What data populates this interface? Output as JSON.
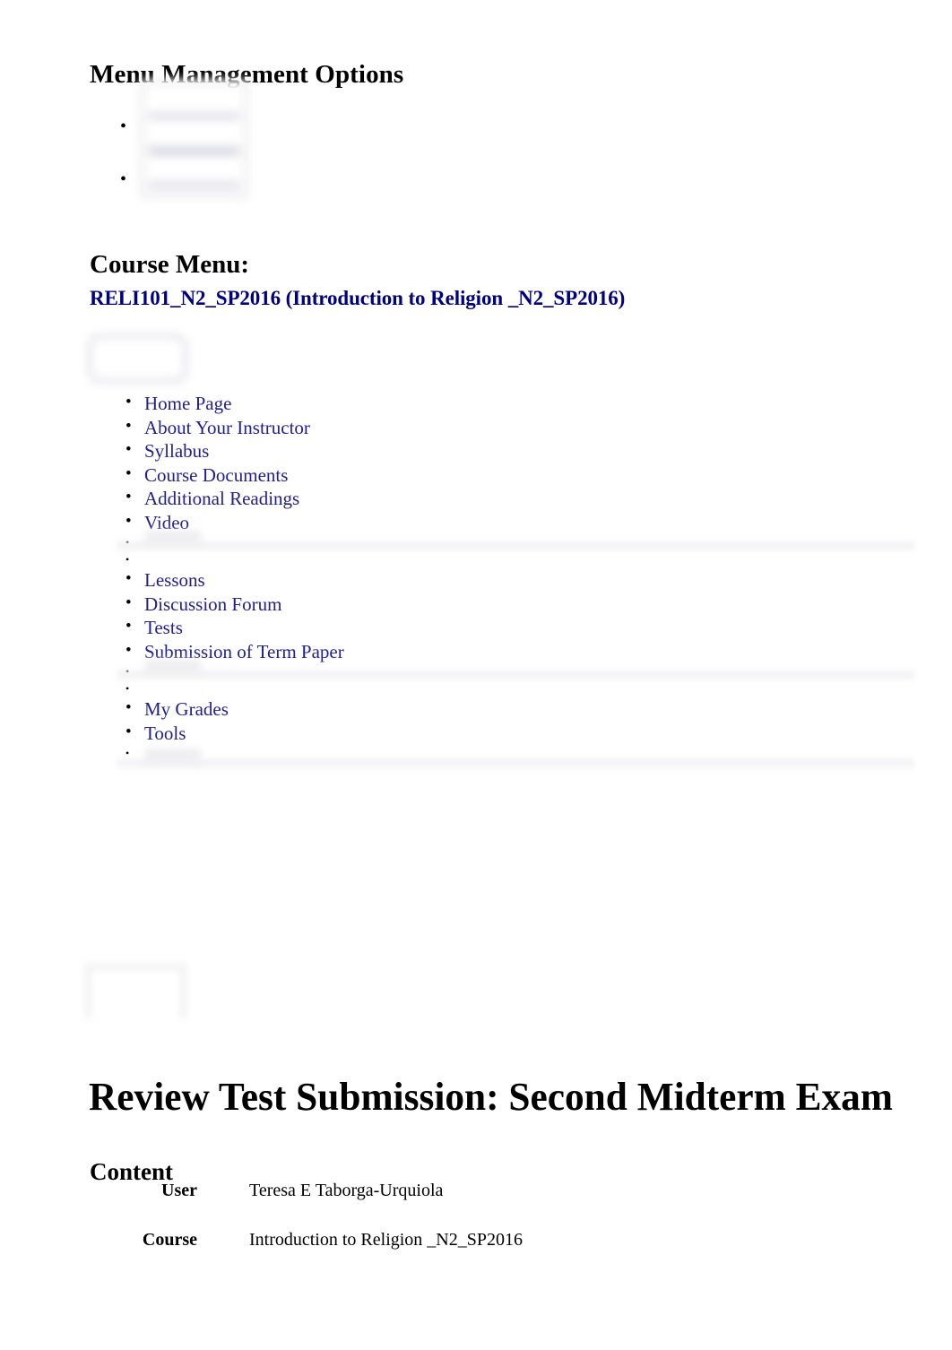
{
  "document": {
    "menu_management_heading": "Menu Management Options",
    "course_menu_heading": "Course Menu:",
    "course_link": "RELI101_N2_SP2016 (Introduction to Religion _N2_SP2016)",
    "page_title": "Review Test Submission: Second Midterm Exam",
    "content_heading": "Content"
  },
  "menu_management_options": [
    {
      "label": ""
    },
    {
      "label": ""
    }
  ],
  "course_menu": {
    "groups": [
      {
        "items": [
          {
            "label": "Home Page"
          },
          {
            "label": "About Your Instructor"
          },
          {
            "label": "Syllabus"
          },
          {
            "label": "Course Documents"
          },
          {
            "label": "Additional Readings"
          },
          {
            "label": "Video"
          },
          {
            "label": ""
          }
        ]
      },
      {
        "items": [
          {
            "label": "Lessons"
          },
          {
            "label": "Discussion Forum"
          },
          {
            "label": "Tests"
          },
          {
            "label": "Submission of Term Paper"
          },
          {
            "label": ""
          }
        ]
      },
      {
        "items": [
          {
            "label": "My Grades"
          },
          {
            "label": "Tools"
          },
          {
            "label": ""
          }
        ]
      }
    ]
  },
  "content_details": {
    "rows": [
      {
        "label": "User",
        "value": "Teresa E Taborga-Urquiola"
      },
      {
        "label": "Course",
        "value": "Introduction to Religion _N2_SP2016"
      }
    ]
  },
  "colors": {
    "link": "#21218e",
    "course_link": "#00007e",
    "text": "#000000",
    "background": "#ffffff",
    "redacted": "#eeeef2"
  }
}
